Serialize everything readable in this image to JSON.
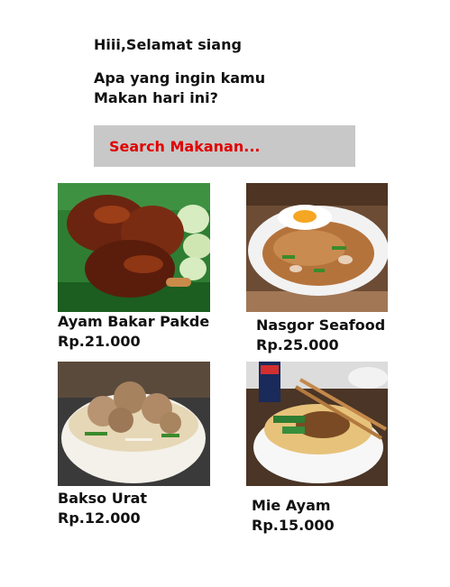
{
  "header": {
    "greeting": "Hiii,Selamat siang",
    "question_line1": "Apa yang ingin kamu",
    "question_line2": "Makan hari ini?"
  },
  "search": {
    "placeholder": "Search Makanan..."
  },
  "foods": [
    {
      "name": "Ayam Bakar Pakde",
      "price": "Rp.21.000",
      "image": "grilled-chicken-photo"
    },
    {
      "name": "Nasgor Seafood",
      "price": "Rp.25.000",
      "image": "fried-rice-photo"
    },
    {
      "name": "Bakso Urat",
      "price": "Rp.12.000",
      "image": "meatball-soup-photo"
    },
    {
      "name": "Mie Ayam",
      "price": "Rp.15.000",
      "image": "chicken-noodle-photo"
    }
  ],
  "colors": {
    "search_bg": "#c8c8c8",
    "search_text": "#e00000",
    "text": "#111111"
  }
}
